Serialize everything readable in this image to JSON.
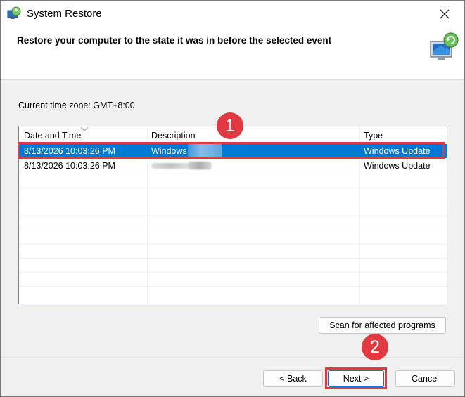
{
  "window": {
    "title": "System Restore",
    "icon": "system-restore-icon",
    "close_icon": "close-icon"
  },
  "header": {
    "text": "Restore your computer to the state it was in before the selected event",
    "icon": "system-restore-monitor-icon"
  },
  "timezone": "Current time zone: GMT+8:00",
  "table": {
    "columns": [
      "Date and Time",
      "Description",
      "Type"
    ],
    "sorted_column": "Date and Time",
    "rows": [
      {
        "date": "8/13/2026 10:03:26 PM",
        "description": "Windows",
        "type": "Windows Update",
        "selected": true
      },
      {
        "date": "8/13/2026 10:03:26 PM",
        "description": "",
        "type": "Windows Update",
        "selected": false
      }
    ]
  },
  "buttons": {
    "scan": "Scan for affected programs",
    "back": "< Back",
    "next": "Next >",
    "cancel": "Cancel"
  },
  "annotations": [
    {
      "number": "1"
    },
    {
      "number": "2"
    }
  ],
  "colors": {
    "selection": "#0078d7",
    "annotation": "#e2383f",
    "background": "#f0f0f0"
  }
}
